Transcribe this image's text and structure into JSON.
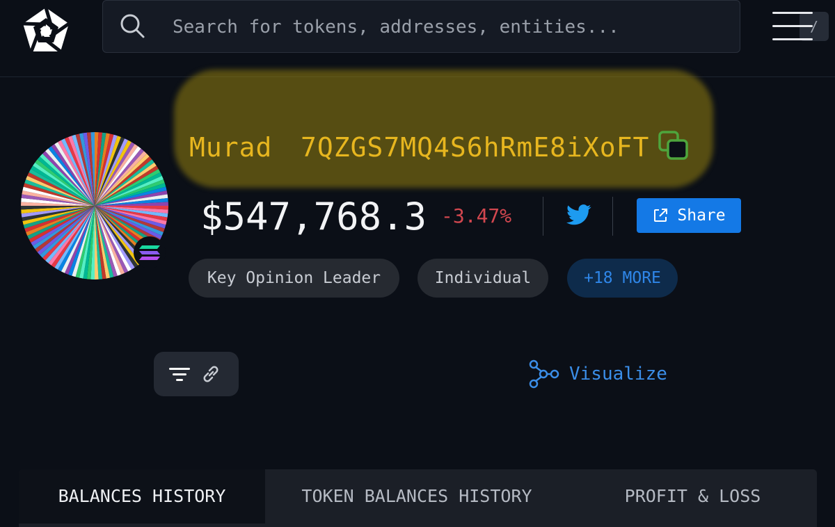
{
  "header": {
    "search_placeholder": "Search for tokens, addresses, entities...",
    "search_shortcut": "/"
  },
  "profile": {
    "name": "Murad",
    "address": "7QZGS7MQ4S6hRmE8iXoFT",
    "balance": "$547,768.3",
    "change": "-3.47%",
    "change_color": "#d2474f",
    "share_label": "Share",
    "chain_icon": "solana-icon",
    "highlight_color": "#96820f",
    "tags": [
      "Key Opinion Leader",
      "Individual",
      "+18 MORE"
    ]
  },
  "toolbar": {
    "visualize_label": "Visualize"
  },
  "tabs": [
    {
      "label": "BALANCES HISTORY",
      "active": true
    },
    {
      "label": "TOKEN BALANCES HISTORY",
      "active": false
    },
    {
      "label": "PROFIT & LOSS",
      "active": false
    }
  ],
  "colors": {
    "accent": "#1479e6",
    "link": "#3b8ee8",
    "name": "#e7b61f"
  }
}
